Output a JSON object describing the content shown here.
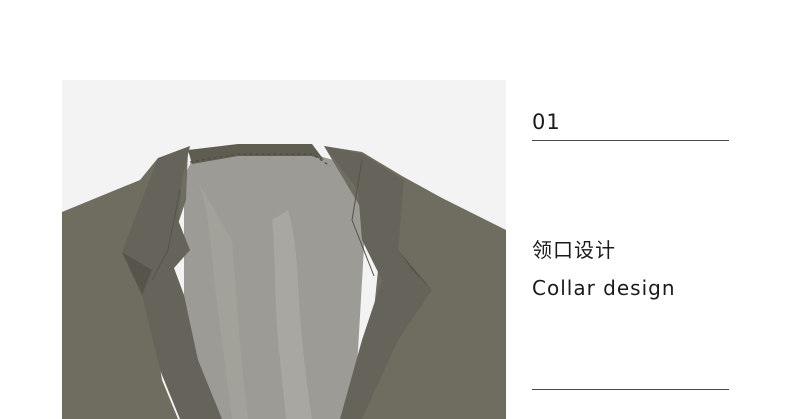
{
  "section": {
    "number": "01",
    "title_cn": "领口设计",
    "title_en": "Collar design"
  },
  "photo": {
    "subject": "jacket-collar-photo",
    "colors": {
      "background": "#f3f3f3",
      "fabric": "#6f6c60",
      "fabric_dark": "#5c594f",
      "lining": "#9c9b95",
      "lining_light": "#b4b3ad"
    }
  }
}
